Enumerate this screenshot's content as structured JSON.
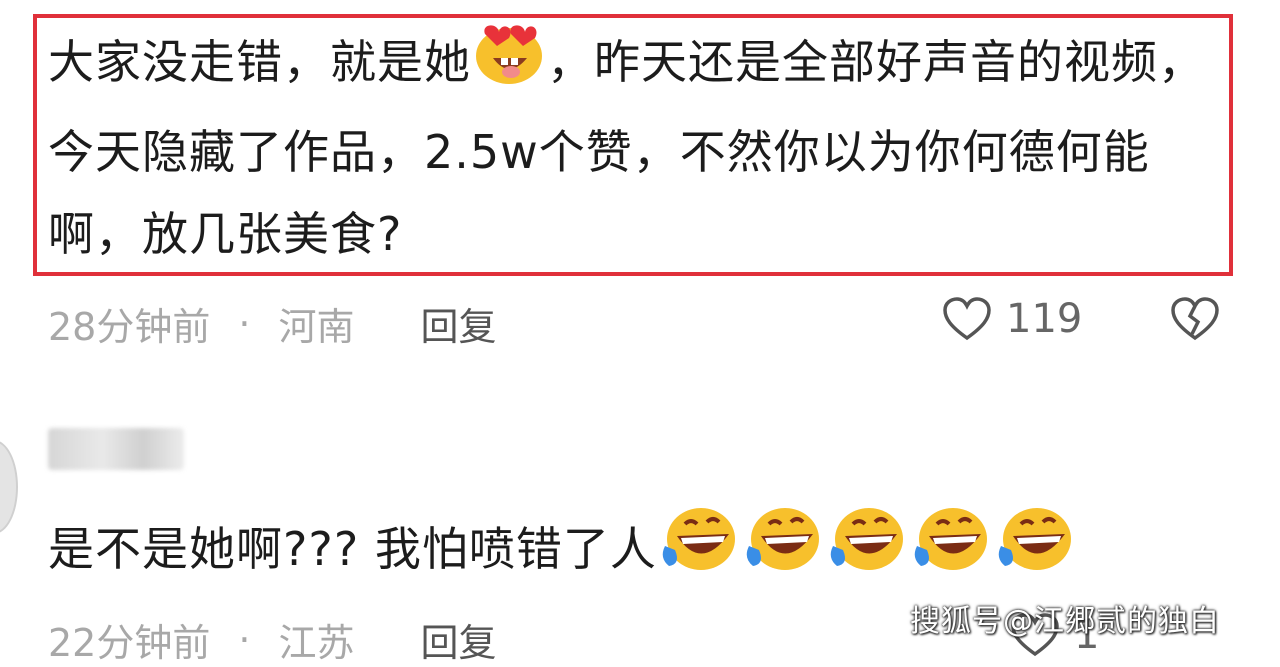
{
  "comment1": {
    "text_part1": "大家没走错，就是她",
    "text_part2": "，昨天还是全部好声音的视频，今天隐藏了作品，2.5w个赞，不然你以为你何德何能啊，放几张美食?",
    "time": "28分钟前",
    "dot": "·",
    "location": "河南",
    "reply": "回复",
    "likes": "119"
  },
  "comment2": {
    "text": "是不是她啊??? 我怕喷错了人",
    "time": "22分钟前",
    "dot": "·",
    "location": "江苏",
    "reply": "回复",
    "likes": "1"
  },
  "watermark": "搜狐号@江郷贰的独白",
  "colors": {
    "highlight_border": "#e0303a",
    "meta_text": "#a8a8a8"
  }
}
